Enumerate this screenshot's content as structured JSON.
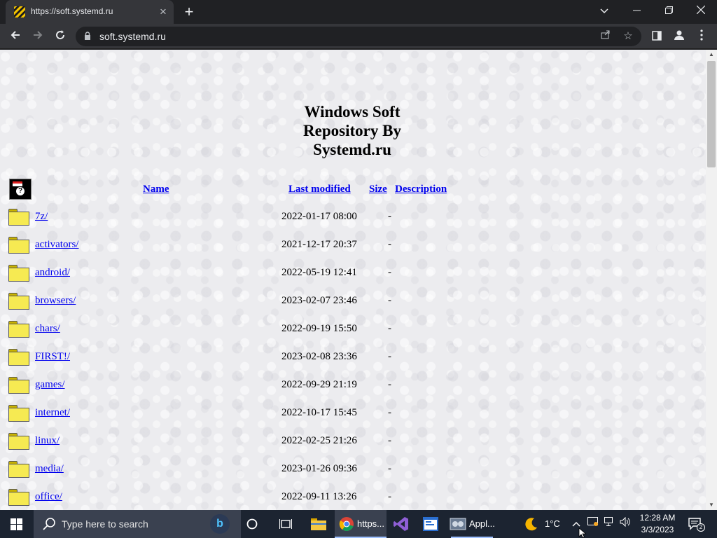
{
  "browser": {
    "tab_title": "https://soft.systemd.ru",
    "url": "soft.systemd.ru"
  },
  "page": {
    "title_lines": [
      "Windows Soft",
      "Repository By",
      "Systemd.ru"
    ],
    "columns": {
      "name": "Name",
      "last_modified": "Last modified",
      "size": "Size",
      "description": "Description"
    },
    "rows": [
      {
        "name": "7z/",
        "date": "2022-01-17 08:00",
        "size": "-"
      },
      {
        "name": "activators/",
        "date": "2021-12-17 20:37",
        "size": "-"
      },
      {
        "name": "android/",
        "date": "2022-05-19 12:41",
        "size": "-"
      },
      {
        "name": "browsers/",
        "date": "2023-02-07 23:46",
        "size": "-"
      },
      {
        "name": "chars/",
        "date": "2022-09-19 15:50",
        "size": "-"
      },
      {
        "name": "FIRST!/",
        "date": "2023-02-08 23:36",
        "size": "-"
      },
      {
        "name": "games/",
        "date": "2022-09-29 21:19",
        "size": "-"
      },
      {
        "name": "internet/",
        "date": "2022-10-17 15:45",
        "size": "-"
      },
      {
        "name": "linux/",
        "date": "2022-02-25 21:26",
        "size": "-"
      },
      {
        "name": "media/",
        "date": "2023-01-26 09:36",
        "size": "-"
      },
      {
        "name": "office/",
        "date": "2022-09-11 13:26",
        "size": "-"
      }
    ]
  },
  "taskbar": {
    "search_placeholder": "Type here to search",
    "chrome_label": "https...",
    "app_label": "Appl...",
    "weather": "1°C",
    "time": "12:28 AM",
    "date": "3/3/2023",
    "notification_count": "2"
  },
  "colors": {
    "link": "#0000ee",
    "taskbar_bg": "#1c2431",
    "chrome_dark": "#202124"
  }
}
